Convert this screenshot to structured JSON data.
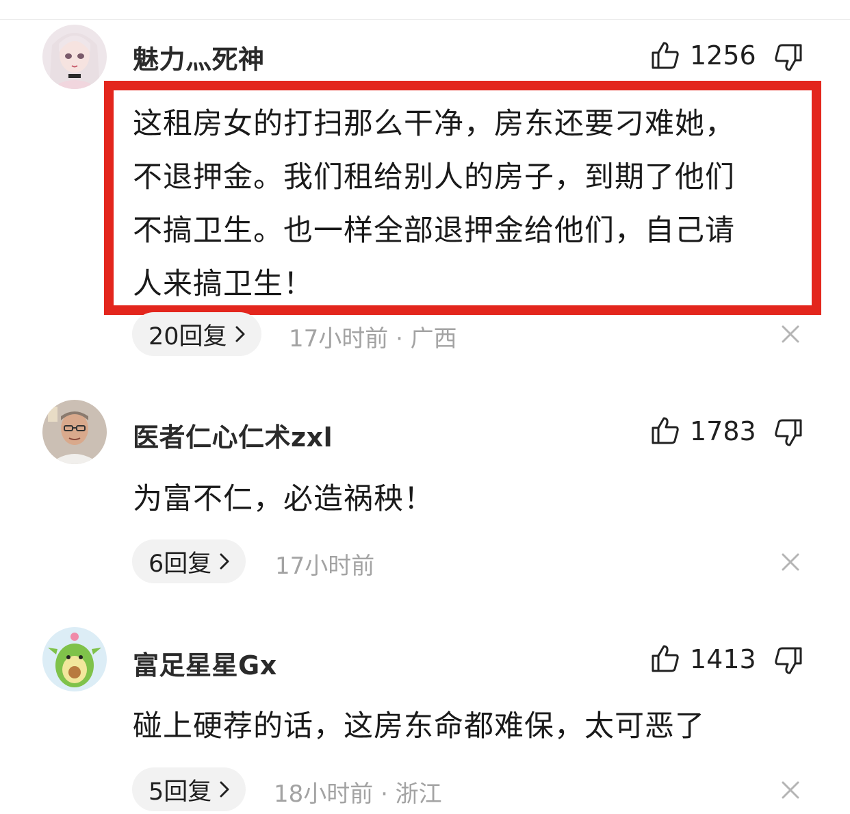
{
  "comments": [
    {
      "username": "魅力灬死神",
      "likes": "1256",
      "text_lines": [
        "这租房女的打扫那么干净，房东还要刁难她，",
        "不退押金。我们租给别人的房子，到期了他们",
        "不搞卫生。也一样全部退押金给他们，自己请",
        "人来搞卫生！"
      ],
      "replies": "20回复",
      "meta": "17小时前 · 广西",
      "avatar_icon": "anime-doll-avatar",
      "highlighted": true
    },
    {
      "username": "医者仁心仁术zxl",
      "likes": "1783",
      "text_lines": [
        "为富不仁，必造祸秧！"
      ],
      "replies": "6回复",
      "meta": "17小时前",
      "avatar_icon": "man-with-glasses-avatar",
      "highlighted": false
    },
    {
      "username": "富足星星Gx",
      "likes": "1413",
      "text_lines": [
        "碰上硬荐的话，这房东命都难保，太可恶了"
      ],
      "replies": "5回复",
      "meta": "18小时前 · 浙江",
      "avatar_icon": "avocado-avatar",
      "highlighted": false
    }
  ],
  "colors": {
    "highlight_border": "#e3261d",
    "meta_text": "#a3a3a3",
    "pill_bg": "#f2f2f2"
  }
}
